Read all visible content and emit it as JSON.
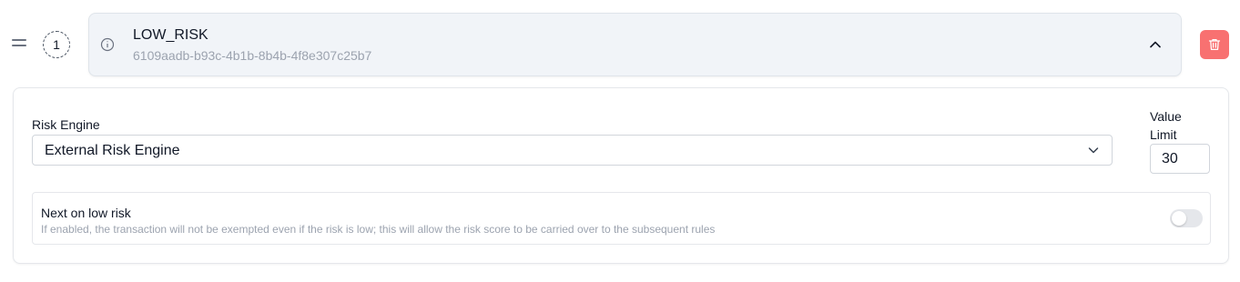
{
  "rule": {
    "order": "1",
    "name": "LOW_RISK",
    "id": "6109aadb-b93c-4b1b-8b4b-4f8e307c25b7"
  },
  "risk_engine": {
    "label": "Risk Engine",
    "selected": "External Risk Engine"
  },
  "value_limit": {
    "label": "Value Limit",
    "value": "30"
  },
  "next_on_low_risk": {
    "title": "Next on low risk",
    "description": "If enabled, the transaction will not be exempted even if the risk is low; this will allow the risk score to be carried over to the subsequent rules",
    "enabled": false
  },
  "icons": {
    "drag": "drag-handle-icon",
    "info": "info-icon",
    "collapse": "chevron-up-icon",
    "delete": "trash-icon",
    "select": "chevron-down-icon"
  },
  "colors": {
    "delete_bg": "#f87171",
    "header_bg": "#f1f4f8"
  }
}
